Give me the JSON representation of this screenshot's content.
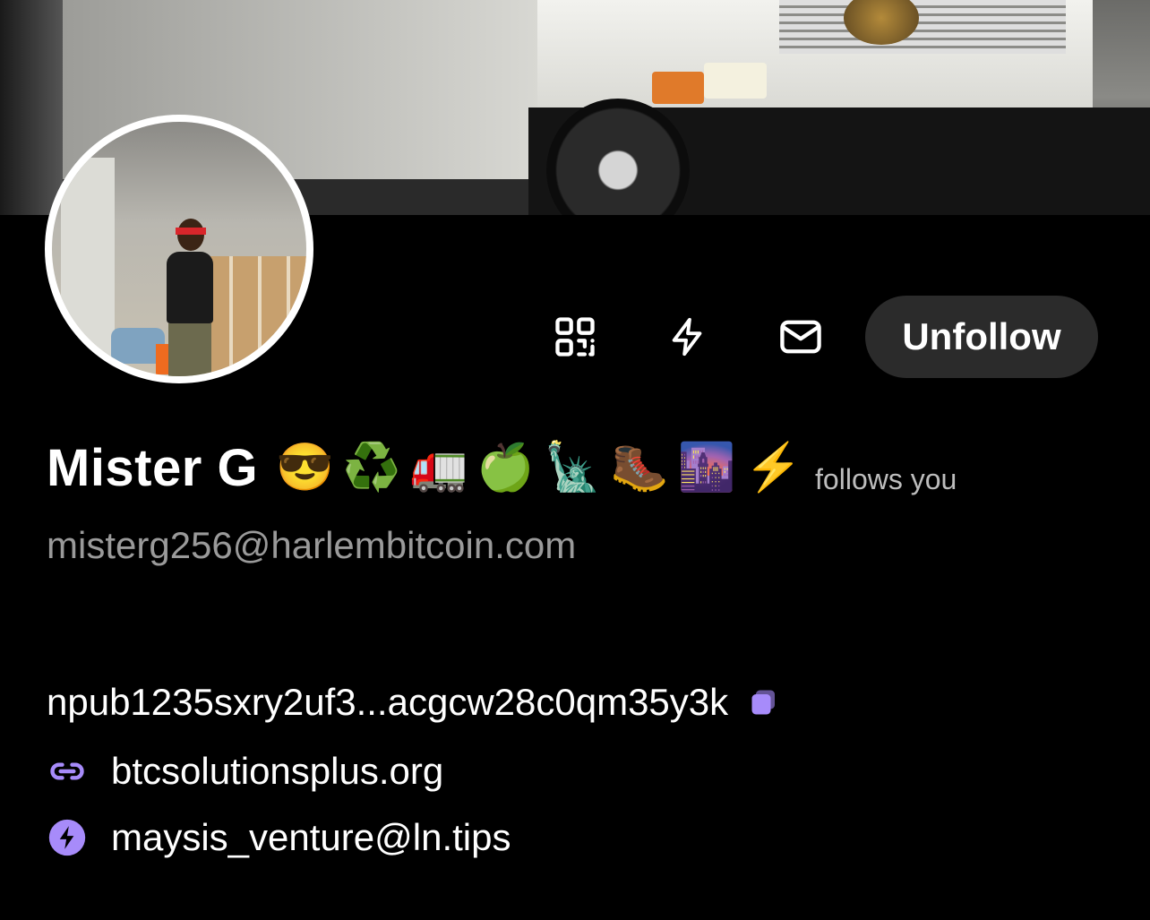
{
  "profile": {
    "display_name": "Mister G",
    "name_emojis": "😎♻️🚛🍏🗽🥾🌆⚡",
    "follows_you": "follows you",
    "nip05": "misterg256@harlembitcoin.com",
    "npub": "npub1235sxry2uf3...acgcw28c0qm35y3k",
    "website": "btcsolutionsplus.org",
    "lightning_address": "maysis_venture@ln.tips"
  },
  "actions": {
    "qr_icon": "qr-code-icon",
    "zap_icon": "lightning-icon",
    "message_icon": "envelope-icon",
    "unfollow_label": "Unfollow"
  },
  "colors": {
    "background": "#000000",
    "accent": "#a78bfa",
    "button_bg": "#2b2b2b",
    "muted_text": "#9a9a9a"
  }
}
